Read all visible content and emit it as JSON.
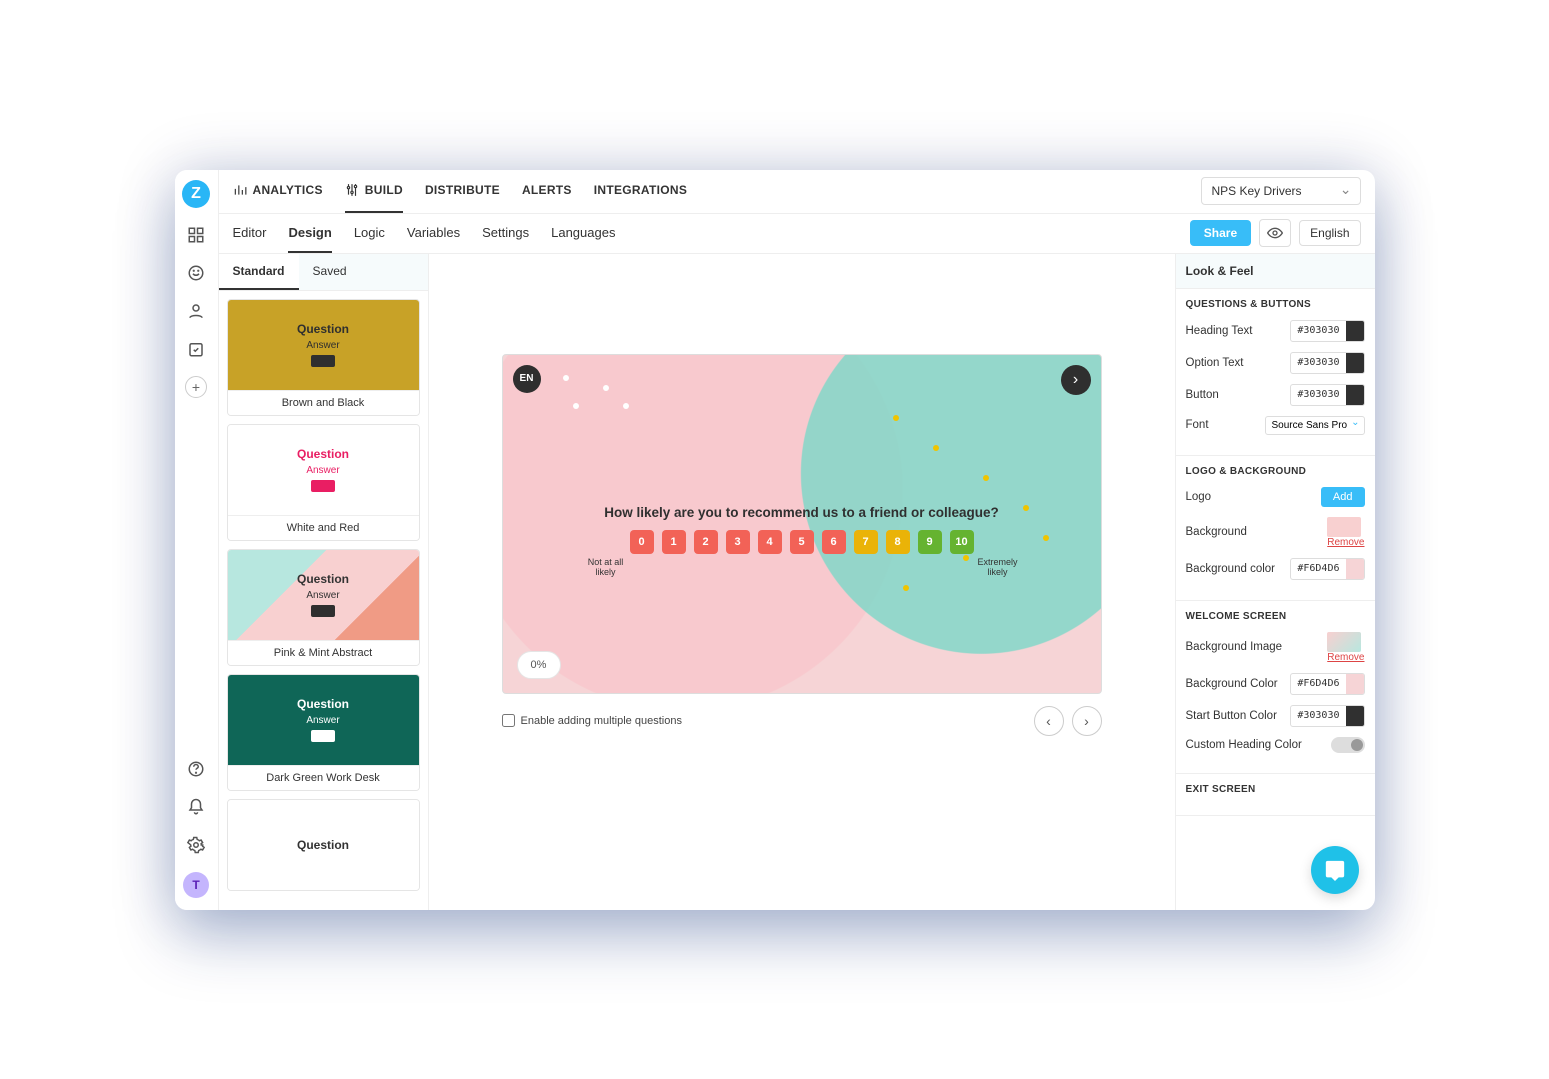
{
  "topnav": {
    "items": [
      "ANALYTICS",
      "BUILD",
      "DISTRIBUTE",
      "ALERTS",
      "INTEGRATIONS"
    ],
    "active_index": 1,
    "survey_selector": "NPS Key Drivers"
  },
  "subnav": {
    "items": [
      "Editor",
      "Design",
      "Logic",
      "Variables",
      "Settings",
      "Languages"
    ],
    "active_index": 1,
    "share_label": "Share",
    "language_label": "English"
  },
  "theme_tabs": {
    "items": [
      "Standard",
      "Saved"
    ],
    "active_index": 0
  },
  "themes": [
    {
      "name": "Brown and Black",
      "question": "Question",
      "answer": "Answer"
    },
    {
      "name": "White and Red",
      "question": "Question",
      "answer": "Answer"
    },
    {
      "name": "Pink & Mint Abstract",
      "question": "Question",
      "answer": "Answer"
    },
    {
      "name": "Dark Green Work Desk",
      "question": "Question",
      "answer": "Answer"
    },
    {
      "name": "",
      "question": "Question",
      "answer": ""
    }
  ],
  "preview": {
    "lang_badge": "EN",
    "question": "How likely are you to recommend us to a friend or colleague?",
    "nps_values": [
      "0",
      "1",
      "2",
      "3",
      "4",
      "5",
      "6",
      "7",
      "8",
      "9",
      "10"
    ],
    "label_low": "Not at all likely",
    "label_high": "Extremely likely",
    "progress": "0%"
  },
  "canvas": {
    "multi_q_label": "Enable adding multiple questions",
    "multi_q_checked": false
  },
  "panel": {
    "title": "Look & Feel",
    "sections": {
      "questions_buttons": {
        "heading": "QUESTIONS & BUTTONS",
        "heading_text_label": "Heading Text",
        "heading_text": "#303030",
        "option_text_label": "Option Text",
        "option_text": "#303030",
        "button_label": "Button",
        "button": "#303030",
        "font_label": "Font",
        "font": "Source Sans Pro"
      },
      "logo_background": {
        "heading": "LOGO & BACKGROUND",
        "logo_label": "Logo",
        "add_label": "Add",
        "background_label": "Background",
        "remove_label": "Remove",
        "bgcolor_label": "Background color",
        "bgcolor": "#F6D4D6"
      },
      "welcome": {
        "heading": "WELCOME SCREEN",
        "bgimg_label": "Background Image",
        "remove_label": "Remove",
        "bgcolor_label": "Background Color",
        "bgcolor": "#F6D4D6",
        "startbtn_label": "Start Button Color",
        "startbtn": "#303030",
        "customheading_label": "Custom Heading Color"
      },
      "exit": {
        "heading": "EXIT SCREEN"
      }
    }
  },
  "avatar_initial": "T"
}
